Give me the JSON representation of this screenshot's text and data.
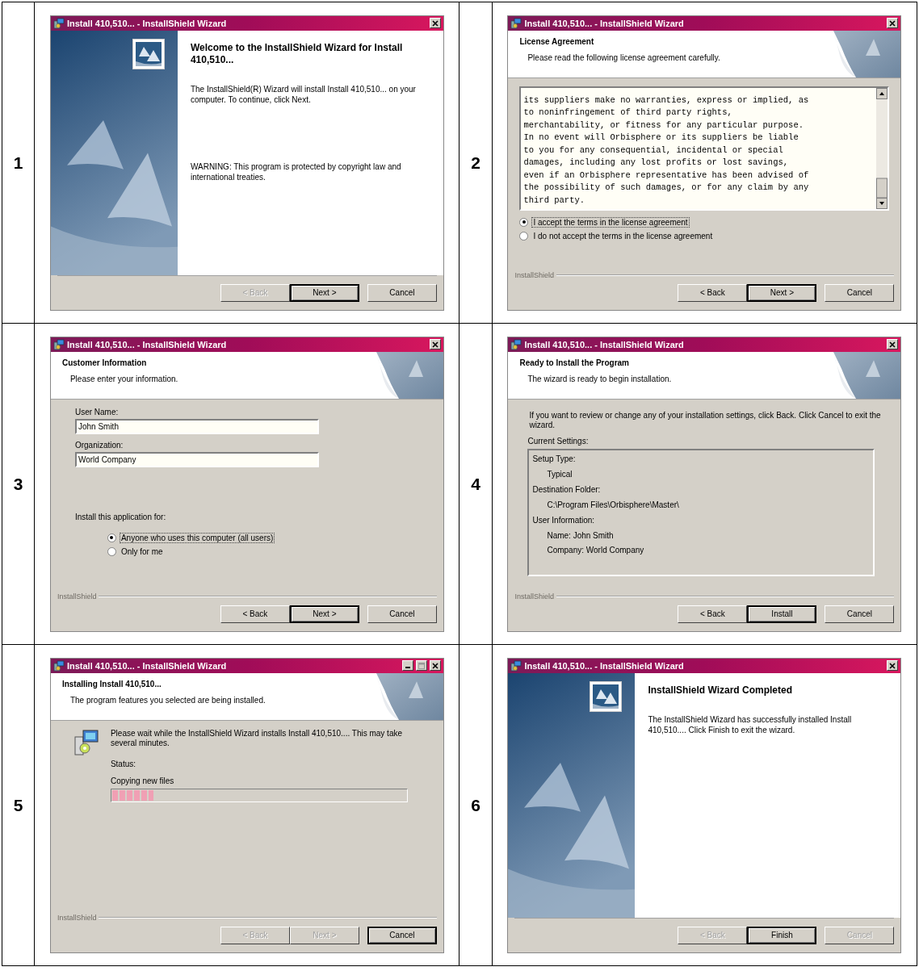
{
  "steps": [
    {
      "number": "1",
      "window": {
        "title": "Install 410,510... - InstallShield Wizard",
        "minimize_box": false,
        "kind": "welcome",
        "heading": "Welcome to the InstallShield Wizard for Install 410,510...",
        "paragraphs": [
          "The InstallShield(R) Wizard will install Install 410,510... on your computer. To continue, click Next.",
          "WARNING: This program is protected by copyright law and international treaties."
        ],
        "buttons": [
          {
            "label": "< Back",
            "disabled": true,
            "default": false
          },
          {
            "label": "Next >",
            "disabled": false,
            "default": true
          },
          {
            "label": "Cancel",
            "disabled": false,
            "default": false
          }
        ]
      }
    },
    {
      "number": "2",
      "window": {
        "title": "Install 410,510... - InstallShield Wizard",
        "minimize_box": false,
        "kind": "page",
        "header": {
          "title": "License Agreement",
          "subtitle": "Please read the following license agreement carefully."
        },
        "body": {
          "kind": "license",
          "lines": [
            "its suppliers make no warranties, express or implied, as",
            "to noninfringement of third party rights,",
            "merchantability, or fitness for any particular purpose.",
            "In no event will Orbisphere or its suppliers be liable",
            "to you for any consequential, incidental or special",
            "damages, including any lost profits or lost savings,",
            "even if an Orbisphere representative has been advised of",
            "the possibility of such damages, or for any claim by any",
            "third party."
          ],
          "options": [
            {
              "label": "I accept the terms in the license agreement",
              "selected": true
            },
            {
              "label": "I do not accept the terms in the license agreement",
              "selected": false
            }
          ]
        },
        "brand": "InstallShield",
        "buttons": [
          {
            "label": "< Back",
            "disabled": false,
            "default": false
          },
          {
            "label": "Next >",
            "disabled": false,
            "default": true
          },
          {
            "label": "Cancel",
            "disabled": false,
            "default": false
          }
        ]
      }
    },
    {
      "number": "3",
      "window": {
        "title": "Install 410,510... - InstallShield Wizard",
        "minimize_box": false,
        "kind": "page",
        "header": {
          "title": "Customer Information",
          "subtitle": "Please enter your information."
        },
        "body": {
          "kind": "customer",
          "fields": [
            {
              "label": "User Name:",
              "value": "John Smith"
            },
            {
              "label": "Organization:",
              "value": "World Company"
            }
          ],
          "group_label": "Install this application for:",
          "options": [
            {
              "label": "Anyone who uses this computer (all users)",
              "selected": true
            },
            {
              "label": "Only for me",
              "selected": false
            }
          ]
        },
        "brand": "InstallShield",
        "buttons": [
          {
            "label": "< Back",
            "disabled": false,
            "default": false
          },
          {
            "label": "Next >",
            "disabled": false,
            "default": true
          },
          {
            "label": "Cancel",
            "disabled": false,
            "default": false
          }
        ]
      }
    },
    {
      "number": "4",
      "window": {
        "title": "Install 410,510... - InstallShield Wizard",
        "minimize_box": false,
        "kind": "page",
        "header": {
          "title": "Ready to Install the Program",
          "subtitle": "The wizard is ready to begin installation."
        },
        "body": {
          "kind": "ready",
          "intro": "If you want to review or change any of your installation settings, click Back. Click Cancel to exit the wizard.",
          "settings_label": "Current Settings:",
          "settings": [
            {
              "label": "Setup Type:",
              "children": [
                "Typical"
              ]
            },
            {
              "label": "Destination Folder:",
              "children": [
                "C:\\Program Files\\Orbisphere\\Master\\"
              ]
            },
            {
              "label": "User Information:",
              "children": [
                "Name: John Smith",
                "Company: World Company"
              ]
            }
          ]
        },
        "brand": "InstallShield",
        "buttons": [
          {
            "label": "< Back",
            "disabled": false,
            "default": false
          },
          {
            "label": "Install",
            "disabled": false,
            "default": true
          },
          {
            "label": "Cancel",
            "disabled": false,
            "default": false
          }
        ]
      }
    },
    {
      "number": "5",
      "window": {
        "title": "Install 410,510... - InstallShield Wizard",
        "minimize_box": true,
        "kind": "page",
        "header": {
          "title": "Installing Install 410,510...",
          "subtitle": "The program features you selected are being installed."
        },
        "body": {
          "kind": "progress",
          "message": "Please wait while the InstallShield Wizard installs Install 410,510.... This may take several minutes.",
          "status_label": "Status:",
          "status": "Copying new files",
          "level": 0.14
        },
        "brand": "InstallShield",
        "buttons": [
          {
            "label": "< Back",
            "disabled": true,
            "default": false
          },
          {
            "label": "Next >",
            "disabled": true,
            "default": false
          },
          {
            "label": "Cancel",
            "disabled": false,
            "default": true
          }
        ]
      }
    },
    {
      "number": "6",
      "window": {
        "title": "Install 410,510... - InstallShield Wizard",
        "minimize_box": false,
        "kind": "welcome",
        "heading": "InstallShield Wizard Completed",
        "paragraphs": [
          "The InstallShield Wizard has successfully installed Install 410,510.... Click Finish to exit the wizard."
        ],
        "buttons": [
          {
            "label": "< Back",
            "disabled": true,
            "default": false
          },
          {
            "label": "Finish",
            "disabled": false,
            "default": true
          },
          {
            "label": "Cancel",
            "disabled": true,
            "default": false
          }
        ]
      }
    }
  ]
}
